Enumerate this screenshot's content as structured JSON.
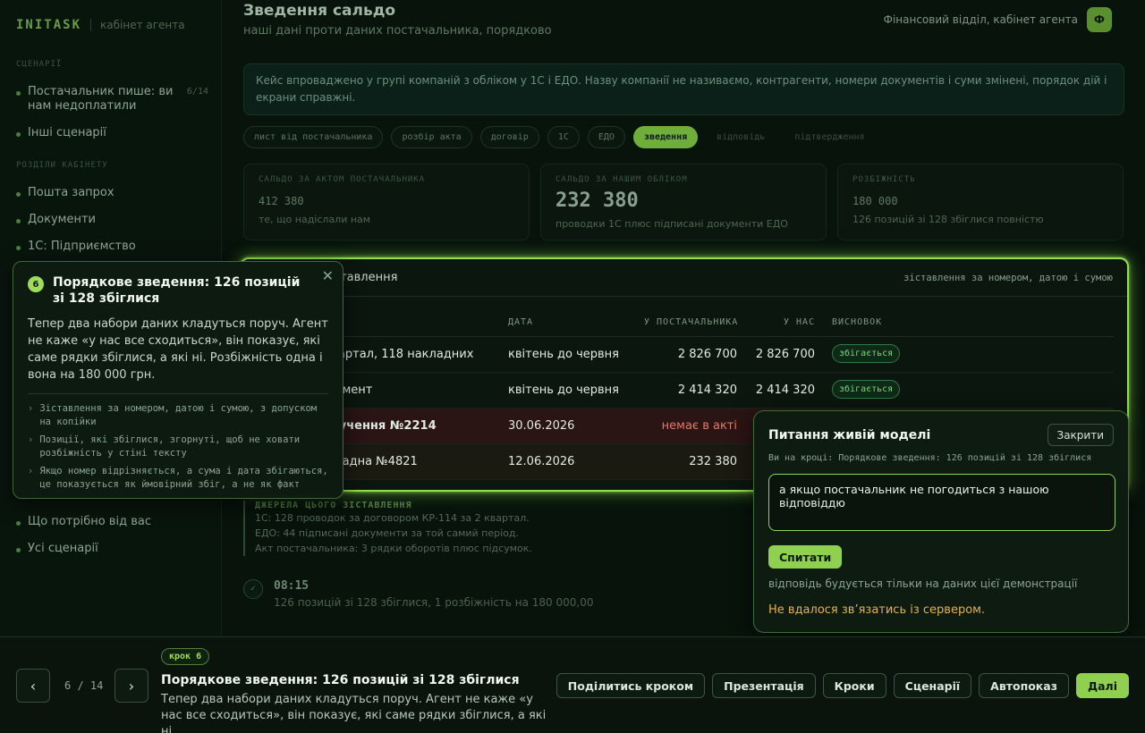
{
  "app": {
    "brand": "INITASK",
    "subtitle": "кабінет агента"
  },
  "sidebar": {
    "section_scenarios": "СЦЕНАРІЇ",
    "scenario_main": "Постачальник пише: ви нам недоплатили",
    "scenario_count": "6/14",
    "scenario_other": "Інші сценарії",
    "section_cabinet": "РОЗДІЛИ КАБІНЕТУ",
    "items": [
      "Пошта запрох",
      "Документи",
      "1С: Підприємство"
    ],
    "bottom_items": [
      "Що потрібно від вас",
      "Усі сценарії"
    ]
  },
  "header": {
    "title": "Зведення сальдо",
    "subtitle": "наші дані проти даних постачальника, порядково",
    "department": "Фінансовий відділ, кабінет агента",
    "avatar": "Ф"
  },
  "notice": "Кейс впроваджено у групі компаній з обліком у 1С і ЕДО. Назву компанії не називаємо, контрагенти, номери документів і суми змінені, порядок дій і екрани справжні.",
  "chips": [
    {
      "label": "лист від постачальника",
      "state": "normal"
    },
    {
      "label": "розбір акта",
      "state": "normal"
    },
    {
      "label": "договір",
      "state": "normal"
    },
    {
      "label": "1С",
      "state": "normal"
    },
    {
      "label": "ЕДО",
      "state": "normal"
    },
    {
      "label": "зведення",
      "state": "active"
    },
    {
      "label": "відповідь",
      "state": "ghost"
    },
    {
      "label": "підтвердження",
      "state": "ghost"
    }
  ],
  "stats": [
    {
      "label": "САЛЬДО ЗА АКТОМ ПОСТАЧАЛЬНИКА",
      "value": "412 380",
      "note": "те, що надіслали нам"
    },
    {
      "label": "САЛЬДО ЗА НАШИМ ОБЛІКОМ",
      "value": "232 380",
      "note": "проводки 1С плюс підписані документи ЕДО"
    },
    {
      "label": "РОЗБІЖНІСТЬ",
      "value": "180 000",
      "note": "126 позицій зі 128 збіглися повністю"
    }
  ],
  "card": {
    "title": "Порядкове зіставлення",
    "hint": "зіставлення за номером, датою і сумою",
    "columns": [
      "ДАТА",
      "У ПОСТАЧАЛЬНИКА",
      "У НАС",
      "ВИСНОВОК"
    ],
    "rows": [
      {
        "doc": "2 квартал, 118 накладних",
        "date": "квітень до червня",
        "supplier": "2 826 700",
        "ours": "2 826 700",
        "status": "збігається"
      },
      {
        "doc": "документ",
        "date": "квітень до червня",
        "supplier": "2 414 320",
        "ours": "2 414 320",
        "status": "збігається"
      },
      {
        "doc": "доручення №2214",
        "date": "30.06.2026",
        "supplier": "немає в акті",
        "ours": "",
        "status": ""
      },
      {
        "doc": "накладна №4821",
        "date": "12.06.2026",
        "supplier": "232 380",
        "ours": "",
        "status": ""
      }
    ]
  },
  "sources": {
    "title": "ДЖЕРЕЛА ЦЬОГО ЗІСТАВЛЕННЯ",
    "lines": [
      "1С: 128 проводок за договором КР-114 за 2 квартал.",
      "ЕДО: 44 підписані документи за той самий період.",
      "Акт постачальника: 3 рядки оборотів плюс підсумок."
    ]
  },
  "timeline": {
    "time": "08:15",
    "text": "126 позицій зі 128 збіглися, 1 розбіжність на 180 000,00"
  },
  "tooltip": {
    "step": "6",
    "title": "Порядкове зведення: 126 позицій зі 128 збіглися",
    "body": "Тепер два набори даних кладуться поруч. Агент не каже «у нас все сходиться», він показує, які саме рядки збіглися, а які ні. Розбіжність одна і вона на 180 000 грн.",
    "bullets": [
      "Зіставлення за номером, датою і сумою, з допуском на копійки",
      "Позиції, які збіглися, згорнуті, щоб не ховати розбіжність у стіні тексту",
      "Якщо номер відрізняється, а сума і дата збігаються, це показується як ймовірний збіг, а не як факт"
    ]
  },
  "ask_panel": {
    "title": "Питання живій моделі",
    "close_label": "Закрити",
    "context": "Ви на кроці: Порядкове зведення: 126 позицій зі 128 збіглися",
    "question": "а якщо постачальник не погодиться з нашою відповіддю",
    "ask_label": "Спитати",
    "note": "відповідь будується тільки на даних цієї демонстрації",
    "error": "Не вдалося зв’язатись із сервером."
  },
  "bottom": {
    "prev_icon": "chevron-left-icon",
    "next_icon": "chevron-right-icon",
    "counter": "6 / 14",
    "step_badge": "крок 6",
    "step_title": "Порядкове зведення: 126 позицій зі 128 збіглися",
    "step_desc": "Тепер два набори даних кладуться поруч. Агент не каже «у нас все сходиться», він показує, які саме рядки збіглися, а які ні.…",
    "actions": [
      "Поділитись кроком",
      "Презентація",
      "Кроки",
      "Сценарії",
      "Автопоказ",
      "Далі"
    ]
  },
  "colors": {
    "accent": "#8fd14f",
    "highlight_border": "#8fe04a",
    "error": "#e3b24a",
    "danger": "#e07a6a"
  }
}
